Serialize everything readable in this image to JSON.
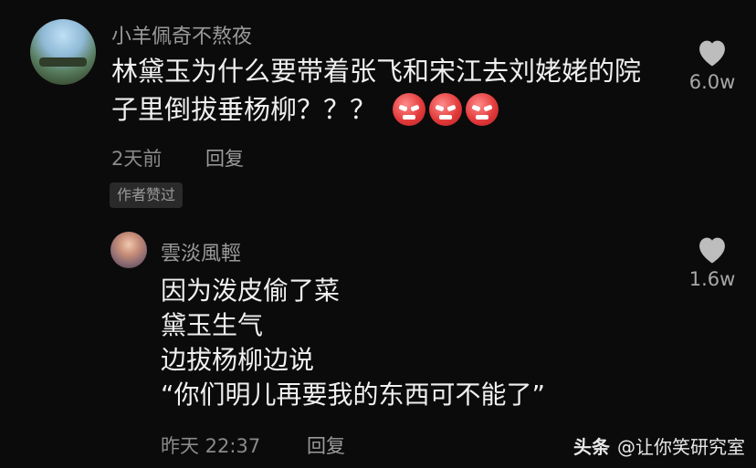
{
  "main_comment": {
    "username": "小羊佩奇不熬夜",
    "text_line1": "林黛玉为什么要带着张飞和宋江去刘姥姥的院",
    "text_line2": "子里倒拔垂杨柳？？？",
    "emoji_count": 3,
    "emoji_icon": "angry-face-emoji",
    "time": "2天前",
    "reply_label": "回复",
    "badge": "作者赞过",
    "like_count": "6.0w"
  },
  "reply_comment": {
    "username": "雲淡風輕",
    "lines": [
      "因为泼皮偷了菜",
      "黛玉生气",
      "边拔杨柳边说",
      "“你们明儿再要我的东西可不能了”"
    ],
    "time": "昨天 22:37",
    "reply_label": "回复",
    "like_count": "1.6w"
  },
  "watermark": {
    "brand": "头条",
    "handle": "@让你笑研究室"
  },
  "colors": {
    "background": "#0b0b0b",
    "text": "#f0f0f0",
    "secondary": "#9a9a9a",
    "emoji": "#e33b3b"
  }
}
